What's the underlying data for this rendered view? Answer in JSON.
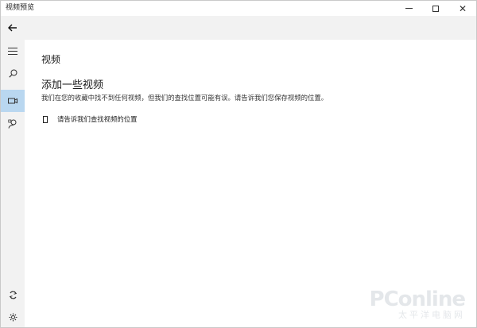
{
  "window": {
    "title": "视频预览",
    "close_glyph": "✕"
  },
  "icons": {
    "back": "back-arrow-icon",
    "menu": "hamburger-icon",
    "search": "search-icon",
    "video": "video-camera-icon",
    "people": "person-icon",
    "sync": "sync-icon",
    "settings": "gear-icon"
  },
  "colors": {
    "sidebar_bg": "#f2f2f2",
    "active_item": "#b9d7f0",
    "text": "#1a1a1a"
  },
  "main": {
    "page_title": "视频",
    "section_title": "添加一些视频",
    "description": "我们在您的收藏中找不到任何视频，但我们的查找位置可能有误。请告诉我们您保存视频的位置。",
    "link_label": "请告诉我们查找视频的位置"
  },
  "watermark": {
    "brand": "PConline",
    "sub": "太平洋电脑网"
  }
}
